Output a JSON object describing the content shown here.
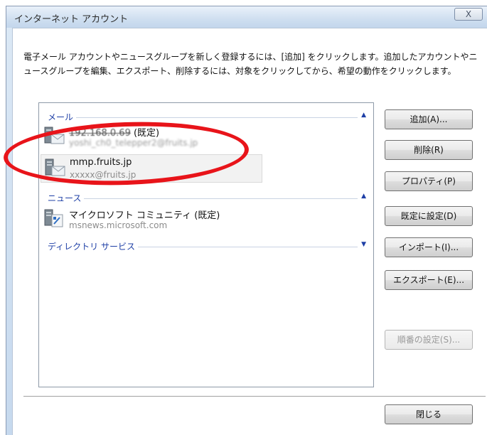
{
  "window": {
    "title": "インターネット アカウント",
    "close_label": "X"
  },
  "description": "電子メール アカウントやニュースグループを新しく登録するには、[追加] をクリックします。追加したアカウントやニュースグループを編集、エクスポート、削除するには、対象をクリックしてから、希望の動作をクリックします。",
  "groups": {
    "mail": {
      "label": "メール"
    },
    "news": {
      "label": "ニュース"
    },
    "directory": {
      "label": "ディレクトリ サービス"
    }
  },
  "accounts": {
    "mail_1": {
      "name": "192.168.0.69",
      "default_tag": "(既定)",
      "sub": "yoshi_ch0_telepper2@fruits.jp"
    },
    "mail_2": {
      "name": "mmp.fruits.jp",
      "sub": "xxxxx@fruits.jp"
    },
    "news_1": {
      "name": "マイクロソフト コミュニティ (既定)",
      "sub": "msnews.microsoft.com"
    }
  },
  "buttons": {
    "add": "追加(A)...",
    "remove": "削除(R)",
    "properties": "プロパティ(P)",
    "set_default": "既定に設定(D)",
    "import": "インポート(I)...",
    "export": "エクスポート(E)...",
    "order": "順番の設定(S)...",
    "close": "閉じる"
  },
  "colors": {
    "group_header": "#1e3fa6",
    "annotation": "#e8141a"
  },
  "icons": {
    "mail_account": "mail-server-icon",
    "news_account": "news-server-icon",
    "collapse": "chevron-up-icon",
    "expand": "chevron-down-icon"
  }
}
